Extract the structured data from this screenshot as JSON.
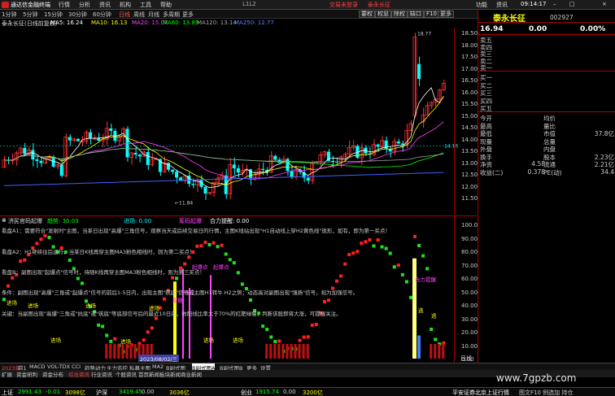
{
  "menubar": {
    "app_name": "通达信金融终端",
    "items": [
      "行情",
      "分析",
      "资讯",
      "机构",
      "工具",
      "帮助"
    ],
    "center": "L1L2",
    "red_items": [
      "交易未登录",
      "泰永长征"
    ],
    "right_items": [
      "功能",
      "资讯"
    ],
    "time": "09:14:17"
  },
  "toolbar": {
    "items": [
      "1分钟",
      "5分钟",
      "15分钟",
      "30分钟",
      "60分钟",
      "日线",
      "周线",
      "月线",
      "多周期",
      "更多"
    ],
    "active": "日线",
    "right_buttons": [
      "要权",
      "权息",
      "除权",
      "缺口",
      "F10",
      "更多"
    ]
  },
  "chart_title": {
    "name": "泰永长征(日线前复权)",
    "ma": [
      {
        "label": "MA5: 16.24",
        "color": "#ffffff"
      },
      {
        "label": "MA10: 16.13",
        "color": "#ffff00"
      },
      {
        "label": "MA20: 15.07",
        "color": "#ff40ff"
      },
      {
        "label": "MA60: 13.89",
        "color": "#00ff00"
      },
      {
        "label": "MA120: 13.14",
        "color": "#a0a0a0"
      },
      {
        "label": "MA250: 12.77",
        "color": "#4060ff"
      }
    ]
  },
  "price_scale": [
    "18.50",
    "18.00",
    "17.50",
    "17.00",
    "16.50",
    "16.00",
    "15.50",
    "15.00",
    "14.50",
    "14.00",
    "13.50",
    "13.00",
    "12.50",
    "12.00",
    "11.50"
  ],
  "price_annotations": {
    "high": "18.77",
    "low": "11.84",
    "current": "14.16"
  },
  "indicator": {
    "title": "济民官码起爆",
    "trend_label": "趋势: 30.03",
    "f1": "进场: 0.00",
    "f2": "筹码起爆",
    "f3": "合力提醒: 0.00",
    "scale": [
      "100.00",
      "90.00",
      "80.00",
      "70.00",
      "60.00",
      "50.00",
      "40.00",
      "30.00",
      "20.00",
      "10.00",
      "0.00"
    ],
    "notes": [
      {
        "text": "看盘A1：需要符合\"发射时\"主图，当某日出现\"高爆\"三角信号，观察当天或后续交易日的行情，主图K线站出现\"H1自动线上穿H2黄色线\"现形，如有，即为第一买点！",
        "color": "#ffff00"
      },
      {
        "text": "看盘A2：H1继续往后运行，当某日K线再穿主图MA3粉色相线时，则为第二买点！",
        "color": "#ffff00"
      },
      {
        "text": "看盘B：副图出现\"起爆点\"信号时，待随K线再穿主图MA3粉色相线时，则为第三买点！",
        "color": "#ffff00"
      },
      {
        "text": "条件：副图出现\"高爆\"三角或\"起爆点\"信号的前后1-5日内，出现主图\"筑底\"信号或主图H1转牛 H2之势；动态高对副图出现\"强扬\"信号，视为加强信号。",
        "color": "#ffff00"
      },
      {
        "text": "关键：当副图出现\"高爆\"三角或\"抗底\"或\"筑底\"等底部信号后的最近10日内，收阳线比率大于70%的红肥绿瘦，判断该股即将大涨，可提醒关注。",
        "color": "#ffff00"
      }
    ],
    "signals": [
      "进场",
      "进场",
      "进场",
      "进场",
      "进场",
      "进场",
      "起爆点",
      "起爆点",
      "提醒",
      "强拉",
      "进场",
      "进场",
      "逃",
      "合力提醒",
      "逃"
    ]
  },
  "bottom_tabs": [
    "2023年",
    "前1",
    "MACD",
    "VOL-TDX",
    "CCI",
    "趋势动力",
    "主力监控",
    "私募主图",
    "MA2",
    "B副式图",
    "B副式图A",
    "B副式图B",
    "更多",
    "设置"
  ],
  "bottom_tabs2": [
    "扩展",
    "资金研判",
    "资金分布",
    "综合资讯",
    "行业资讯",
    "个股资讯",
    "首页新闻",
    "板块新闻",
    "商业新闻"
  ],
  "date_label": "2023/08/02/三",
  "right_tag": "日线",
  "ticker": [
    {
      "text": "上证",
      "color": "#ffffff"
    },
    {
      "text": "2991.43",
      "color": "#00ff00"
    },
    {
      "text": "-0.01",
      "color": "#00ff00"
    },
    {
      "text": "3098亿",
      "color": "#ffff00"
    },
    {
      "text": "沪深",
      "color": "#ffffff"
    },
    {
      "text": "3419.45",
      "color": "#00ff00"
    },
    {
      "text": "0.00",
      "color": "#ccc"
    },
    {
      "text": "3036亿",
      "color": "#ffff00"
    },
    {
      "text": "创业",
      "color": "#ffffff"
    },
    {
      "text": "1915.74",
      "color": "#00ff00"
    },
    {
      "text": "0.00",
      "color": "#ccc"
    },
    {
      "text": "3200亿",
      "color": "#ffff00"
    },
    {
      "text": "平安证券北京上证行情",
      "color": "#ffffff"
    }
  ],
  "ticker_right": "图文F10 例选加 持仓",
  "watermark": "www.7gpzb.com",
  "quote": {
    "name": "泰永长征",
    "code": "002927",
    "price": "16.94",
    "change": "0.00",
    "pct": "0.00%",
    "sells": [
      "卖五",
      "卖四",
      "卖三",
      "卖二",
      "卖一"
    ],
    "buys": [
      "买一",
      "买二",
      "买三",
      "买四",
      "买五"
    ],
    "stats_left": [
      {
        "k": "今开",
        "v": ""
      },
      {
        "k": "最高",
        "v": ""
      },
      {
        "k": "最低",
        "v": ""
      },
      {
        "k": "现量",
        "v": ""
      },
      {
        "k": "外盘",
        "v": ""
      },
      {
        "k": "换手",
        "v": ""
      },
      {
        "k": "净资",
        "v": "4.58"
      },
      {
        "k": "收益(二)",
        "v": "0.378"
      }
    ],
    "stats_right": [
      {
        "k": "均价",
        "v": ""
      },
      {
        "k": "量比",
        "v": ""
      },
      {
        "k": "市值",
        "v": "37.8亿"
      },
      {
        "k": "总量",
        "v": ""
      },
      {
        "k": "内盘",
        "v": ""
      },
      {
        "k": "股本",
        "v": "2.23亿"
      },
      {
        "k": "流通",
        "v": "2.21亿"
      },
      {
        "k": "PE(动)",
        "v": "34.4"
      }
    ]
  },
  "colors": {
    "red": "#ff3030",
    "green": "#00ff00",
    "cyan": "#00ffff",
    "yellow": "#ffff00",
    "magenta": "#ff40ff",
    "frame": "#aa0000"
  }
}
